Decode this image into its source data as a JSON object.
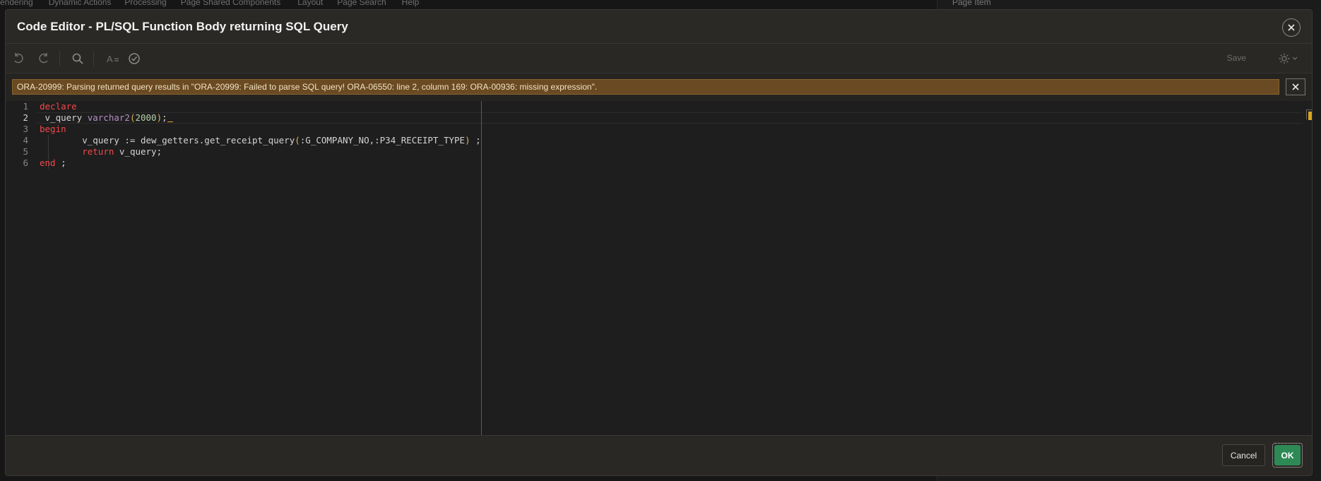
{
  "background": {
    "tabs": [
      "endering",
      "Dynamic Actions",
      "Processing",
      "Page Shared Components",
      "Layout",
      "Page Search",
      "Help"
    ],
    "right_panel_title": "Page Item"
  },
  "dialog": {
    "title": "Code Editor - PL/SQL Function Body returning SQL Query",
    "close_icon": "close-icon"
  },
  "toolbar": {
    "undo_icon": "undo-icon",
    "redo_icon": "redo-icon",
    "search_icon": "search-icon",
    "autocomplete_icon": "autocomplete-icon",
    "validate_icon": "validate-icon",
    "save_label": "Save",
    "settings_icon": "gear-icon"
  },
  "error": {
    "message": "ORA-20999: Parsing returned query results in \"ORA-20999: Failed to parse SQL query! ORA-06550: line 2, column 169: ORA-00936: missing expression\".",
    "color": "#6a4a22"
  },
  "editor": {
    "active_line": 2,
    "line_numbers": [
      "1",
      "2",
      "3",
      "4",
      "5",
      "6"
    ],
    "lines": [
      {
        "kw": "declare"
      },
      {
        "pre": " v_query ",
        "type": "varchar2",
        "open": "(",
        "num": "2000",
        "close": ")",
        "post": ";"
      },
      {
        "kw": "begin"
      },
      {
        "pre": "        v_query := dew_getters.get_receipt_query",
        "open": "(",
        "mid": ":G_COMPANY_NO,:P34_RECEIPT_TYPE",
        "close": ")",
        "post": " ;"
      },
      {
        "indent": "        ",
        "kw": "return",
        "post": " v_query;"
      },
      {
        "kw": "end",
        "post": " ;"
      }
    ]
  },
  "footer": {
    "cancel_label": "Cancel",
    "ok_label": "OK",
    "ok_color": "#2e8a55"
  }
}
